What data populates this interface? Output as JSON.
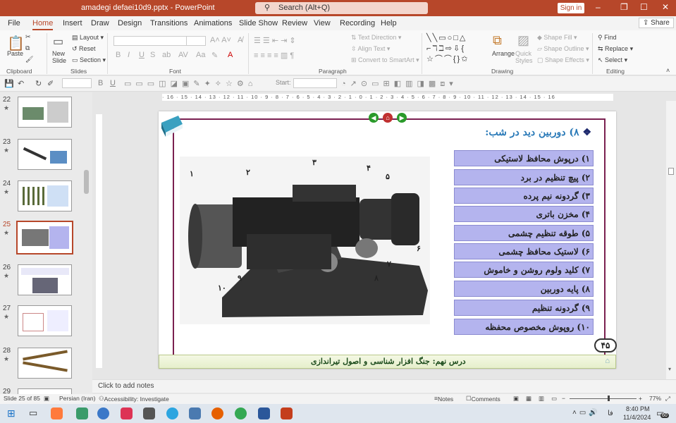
{
  "titlebar": {
    "filename": "amadegi defaei10d9.pptx",
    "app": "PowerPoint",
    "search_placeholder": "Search (Alt+Q)",
    "signin": "Sign in"
  },
  "menu": [
    "File",
    "Home",
    "Insert",
    "Draw",
    "Design",
    "Transitions",
    "Animations",
    "Slide Show",
    "Review",
    "View",
    "Recording",
    "Help"
  ],
  "share": "Share",
  "ribbon": {
    "clipboard": {
      "paste": "Paste",
      "group": "Clipboard"
    },
    "slides": {
      "new_slide": "New Slide",
      "layout": "Layout",
      "reset": "Reset",
      "section": "Section",
      "group": "Slides"
    },
    "font": {
      "group": "Font"
    },
    "paragraph": {
      "text_direction": "Text Direction",
      "align_text": "Align Text",
      "smartart": "Convert to SmartArt",
      "group": "Paragraph"
    },
    "drawing": {
      "arrange": "Arrange",
      "quick_styles": "Quick Styles",
      "shape_fill": "Shape Fill",
      "shape_outline": "Shape Outline",
      "shape_effects": "Shape Effects",
      "group": "Drawing"
    },
    "editing": {
      "find": "Find",
      "replace": "Replace",
      "select": "Select",
      "group": "Editing"
    }
  },
  "qat": {
    "start_label": "Start:"
  },
  "thumbnails": [
    {
      "num": "22"
    },
    {
      "num": "23"
    },
    {
      "num": "24"
    },
    {
      "num": "25",
      "selected": true
    },
    {
      "num": "26"
    },
    {
      "num": "27"
    },
    {
      "num": "28"
    },
    {
      "num": "29"
    }
  ],
  "ruler_text": "· 16 · 15 · 14 · 13 · 12 · 11 · 10 · 9 · 8 · 7 · 6 · 5 · 4 · 3 · 2 · 1 · 0 · 1 · 2 · 3 · 4 · 5 · 6 · 7 · 8 · 9 · 10 · 11 · 12 · 13 · 14 · 15 · 16",
  "slide": {
    "heading": "۸) دوربین دید در شب:",
    "items": [
      "۱) درپوش محافظ لاستیکی",
      "۲) پیچ تنظیم در برد",
      "۳) گردونه نیم پرده",
      "۴) مخزن باتری",
      "۵) طوقه تنظیم چشمی",
      "۶) لاستیک محافظ چشمی",
      "۷) کلید ولوم روشن و خاموش",
      "۸) پایه دوربین",
      "۹) گردونه تنظیم",
      "۱۰) روپوش مخصوص محفظه"
    ],
    "page_num": "۴۵",
    "footer": "درس نهم: جنگ افزار شناسی  و اصول تیراندازی",
    "callouts": [
      "۱",
      "۲",
      "۳",
      "۴",
      "۵",
      "۶",
      "۷",
      "۸",
      "۹",
      "۱۰"
    ]
  },
  "notes_placeholder": "Click to add notes",
  "status": {
    "slide_info": "Slide 25 of 85",
    "language": "Persian (Iran)",
    "accessibility": "Accessibility: Investigate",
    "notes": "Notes",
    "comments": "Comments",
    "zoom": "77%"
  },
  "taskbar": {
    "time": "8:40 PM",
    "date": "11/4/2024",
    "lang": "فا",
    "badge": "60"
  }
}
